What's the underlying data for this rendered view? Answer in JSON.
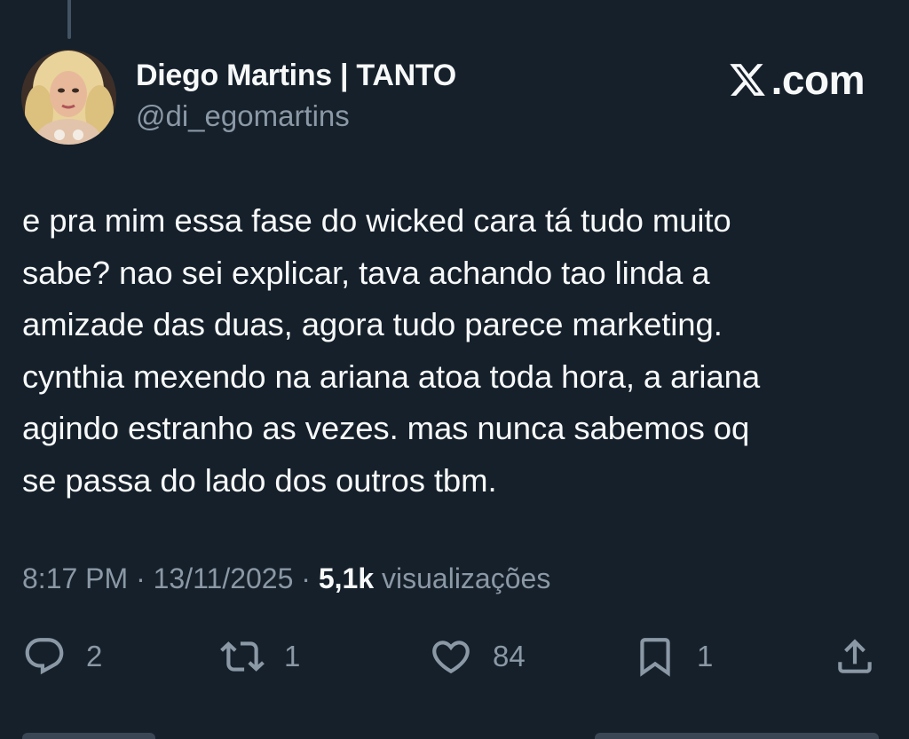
{
  "author": {
    "display_name": "Diego Martins | TANTO",
    "handle": "@di_egomartins"
  },
  "brand": {
    "icon": "x-logo-icon",
    "text": ".com"
  },
  "tweet": {
    "lines": [
      "e pra mim essa fase do wicked cara tá tudo muito",
      "sabe? nao sei explicar, tava achando tao linda a",
      "amizade das duas, agora tudo parece marketing.",
      "cynthia mexendo na ariana atoa toda hora, a ariana",
      "agindo estranho as vezes. mas nunca sabemos oq",
      "se passa do lado dos outros tbm."
    ]
  },
  "meta": {
    "time": "8:17 PM",
    "separator": "·",
    "date": "13/11/2025",
    "views_count": "5,1k",
    "views_label": "visualizações"
  },
  "actions": {
    "replies": "2",
    "retweets": "1",
    "likes": "84",
    "bookmarks": "1"
  },
  "colors": {
    "background": "#15202b",
    "text_primary": "#f7f9f9",
    "text_secondary": "#8b98a5"
  }
}
